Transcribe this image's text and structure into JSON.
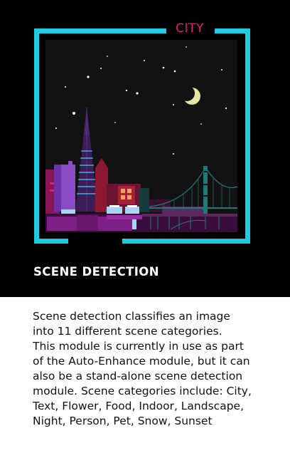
{
  "illustration": {
    "label": "CITY",
    "frame_color": "#1ecbe1",
    "label_color": "#e8196e",
    "moon_color": "#e9e3a6",
    "sky_color": "#121212"
  },
  "section": {
    "title": "SCENE DETECTION"
  },
  "description": {
    "text": "Scene detection classifies an image\ninto 11 different scene categories.\nThis module is currently in use as part\nof the Auto-Enhance module, but it can\nalso be a stand-alone scene detection\nmodule.  Scene categories include: City,\nText, Flower, Food, Indoor, Landscape,\nNight, Person, Pet, Snow, Sunset"
  }
}
